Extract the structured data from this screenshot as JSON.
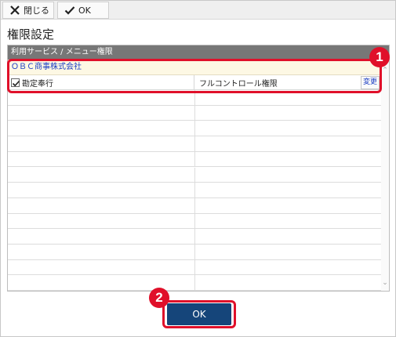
{
  "toolbar": {
    "close_label": "閉じる",
    "ok_label": "OK"
  },
  "page": {
    "title": "権限設定"
  },
  "grid": {
    "header": "利用サービス / メニュー権限",
    "company": "ＯＢＣ商事株式会社",
    "app": {
      "name": "勘定奉行",
      "checked": true,
      "permission": "フルコントロール権限",
      "change_label": "変更"
    },
    "empty_rows": 13
  },
  "callouts": {
    "badge1": "1",
    "badge2": "2"
  },
  "footer": {
    "ok_label": "OK"
  },
  "colors": {
    "header_bg": "#777777",
    "company_bg": "#fdf8e4",
    "link_blue": "#1d3fc4",
    "highlight_red": "#e0102a",
    "primary_button": "#15457a"
  }
}
